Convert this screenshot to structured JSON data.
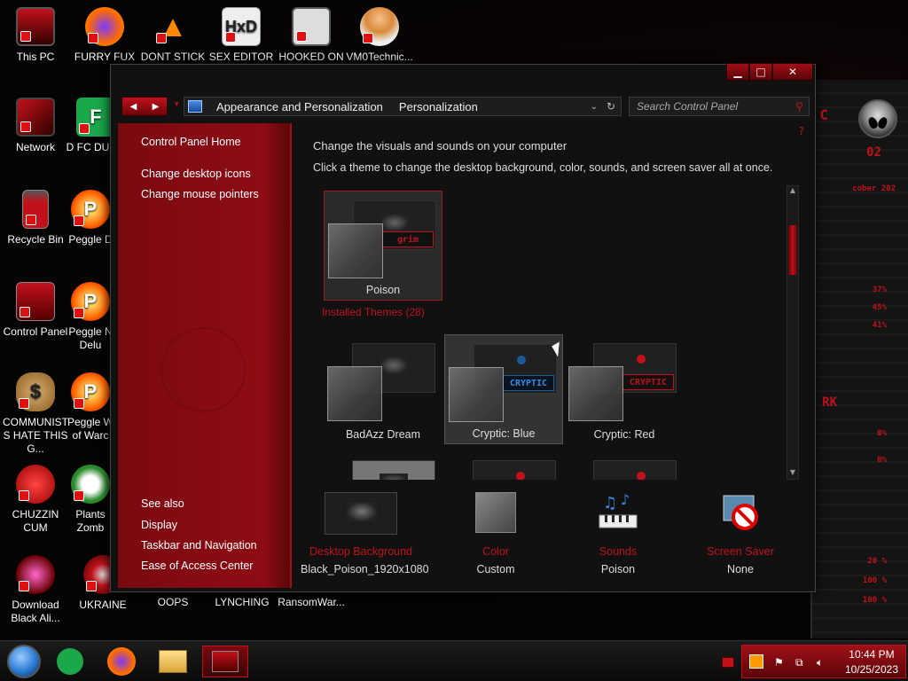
{
  "desktop": {
    "icons": [
      {
        "label": "This PC"
      },
      {
        "label": "FURRY FUX"
      },
      {
        "label": "DONT STICK"
      },
      {
        "label": "SEX EDITOR"
      },
      {
        "label": "HOOKED ON"
      },
      {
        "label": "VM0Technic..."
      },
      {
        "label": "Network"
      },
      {
        "label": "D FC DUMB"
      },
      {
        "label": "Recycle Bin"
      },
      {
        "label": "Peggle D"
      },
      {
        "label": "Control Panel"
      },
      {
        "label": "Peggle N Delu"
      },
      {
        "label": "COMMUNISTS HATE THIS G..."
      },
      {
        "label": "Peggle W of Warc"
      },
      {
        "label": "CHUZZIN CUM"
      },
      {
        "label": "Plants Zomb"
      },
      {
        "label": "Download Black Ali..."
      },
      {
        "label": "UKRAINE"
      },
      {
        "label": "OOPS"
      },
      {
        "label": "LYNCHING"
      },
      {
        "label": "RansomWar..."
      }
    ],
    "hud_labels": [
      "C",
      "02",
      "cober 202",
      "37%",
      "45%",
      "41%",
      "RK",
      "0%",
      "0%",
      "20 %",
      "100 %",
      "100 %"
    ]
  },
  "window": {
    "controls": {
      "minimize": "▁",
      "maximize": "□",
      "close": "✕"
    },
    "address": {
      "crumbs": [
        "Appearance and Personalization",
        "Personalization"
      ],
      "search_placeholder": "Search Control Panel"
    },
    "sidebar": {
      "home": "Control Panel Home",
      "links": [
        "Change desktop icons",
        "Change mouse pointers"
      ],
      "see_also_title": "See also",
      "see_also": [
        "Display",
        "Taskbar and Navigation",
        "Ease of Access Center"
      ]
    },
    "main": {
      "title": "Change the visuals and sounds on your computer",
      "subtitle": "Click a theme to change the desktop background, color, sounds, and screen saver all at once.",
      "my_theme": {
        "name": "Poison",
        "logo": "grim"
      },
      "installed_label": "Installed Themes (28)",
      "themes": [
        {
          "name": "BadAzz Dream",
          "logo": ""
        },
        {
          "name": "Cryptic: Blue",
          "logo": "CRYPTIC"
        },
        {
          "name": "Cryptic: Red",
          "logo": "CRYPTIC"
        }
      ]
    },
    "bottom": {
      "desktop_background": {
        "label": "Desktop Background",
        "value": "Black_Poison_1920x1080"
      },
      "color": {
        "label": "Color",
        "value": "Custom"
      },
      "sounds": {
        "label": "Sounds",
        "value": "Poison"
      },
      "screen_saver": {
        "label": "Screen Saver",
        "value": "None"
      }
    }
  },
  "taskbar": {
    "time": "10:44 PM",
    "date": "10/25/2023"
  },
  "colors": {
    "accent": "#c1121b",
    "accent_dark": "#7a0a10",
    "text": "#dddddd"
  }
}
